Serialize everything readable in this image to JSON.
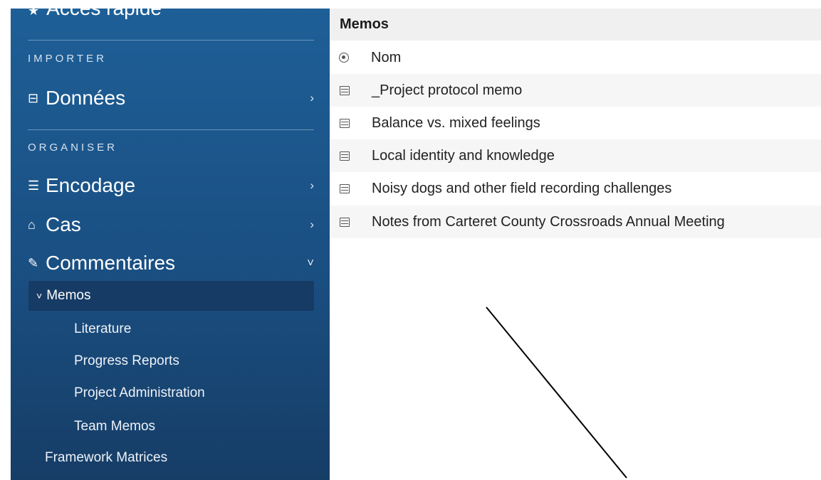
{
  "sidebar": {
    "quick_access": "Accès rapide",
    "section_import": "IMPORTER",
    "nav_donnees": "Données",
    "section_organise": "ORGANISER",
    "nav_encodage": "Encodage",
    "nav_cas": "Cas",
    "nav_commentaires": "Commentaires",
    "memos_label": "Memos",
    "memos_children": [
      "Literature",
      "Progress Reports",
      "Project Administration",
      "Team Memos"
    ],
    "framework_matrices": "Framework Matrices"
  },
  "main": {
    "title": "Memos",
    "column_header": "Nom",
    "rows": [
      "_Project protocol memo",
      "Balance vs. mixed feelings",
      "Local identity and knowledge",
      "Noisy dogs and other field recording challenges",
      "Notes from Carteret County Crossroads Annual Meeting"
    ]
  }
}
